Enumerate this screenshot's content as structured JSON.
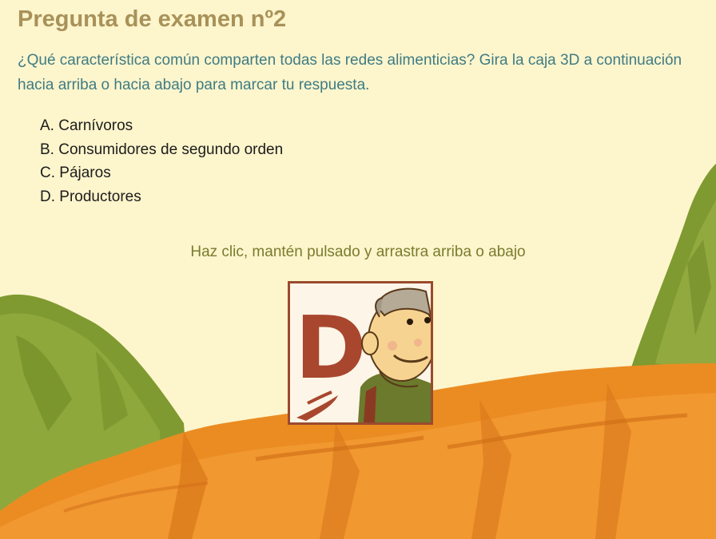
{
  "exam": {
    "title": "Pregunta de examen nº2",
    "question": "¿Qué característica común comparten todas las redes alimenticias? Gira la caja 3D a continuación hacia arriba o hacia abajo para marcar tu respuesta.",
    "options": [
      "A. Carnívoros",
      "B. Consumidores de segundo orden",
      "C. Pájaros",
      "D. Productores"
    ],
    "instruction": "Haz clic, mantén pulsado y arrastra arriba o abajo"
  },
  "answer_cube": {
    "current_face_letter": "D",
    "icon": "caveman-character-icon"
  },
  "colors": {
    "background": "#fdf5cc",
    "title": "#a8925a",
    "question_text": "#3f7c84",
    "option_text": "#1c1c1c",
    "instruction_text": "#7a7c2e",
    "cube_border": "#9a4a2e",
    "letter": "#a8472e",
    "hills": "#8ea33c",
    "ground": "#e8891f"
  }
}
